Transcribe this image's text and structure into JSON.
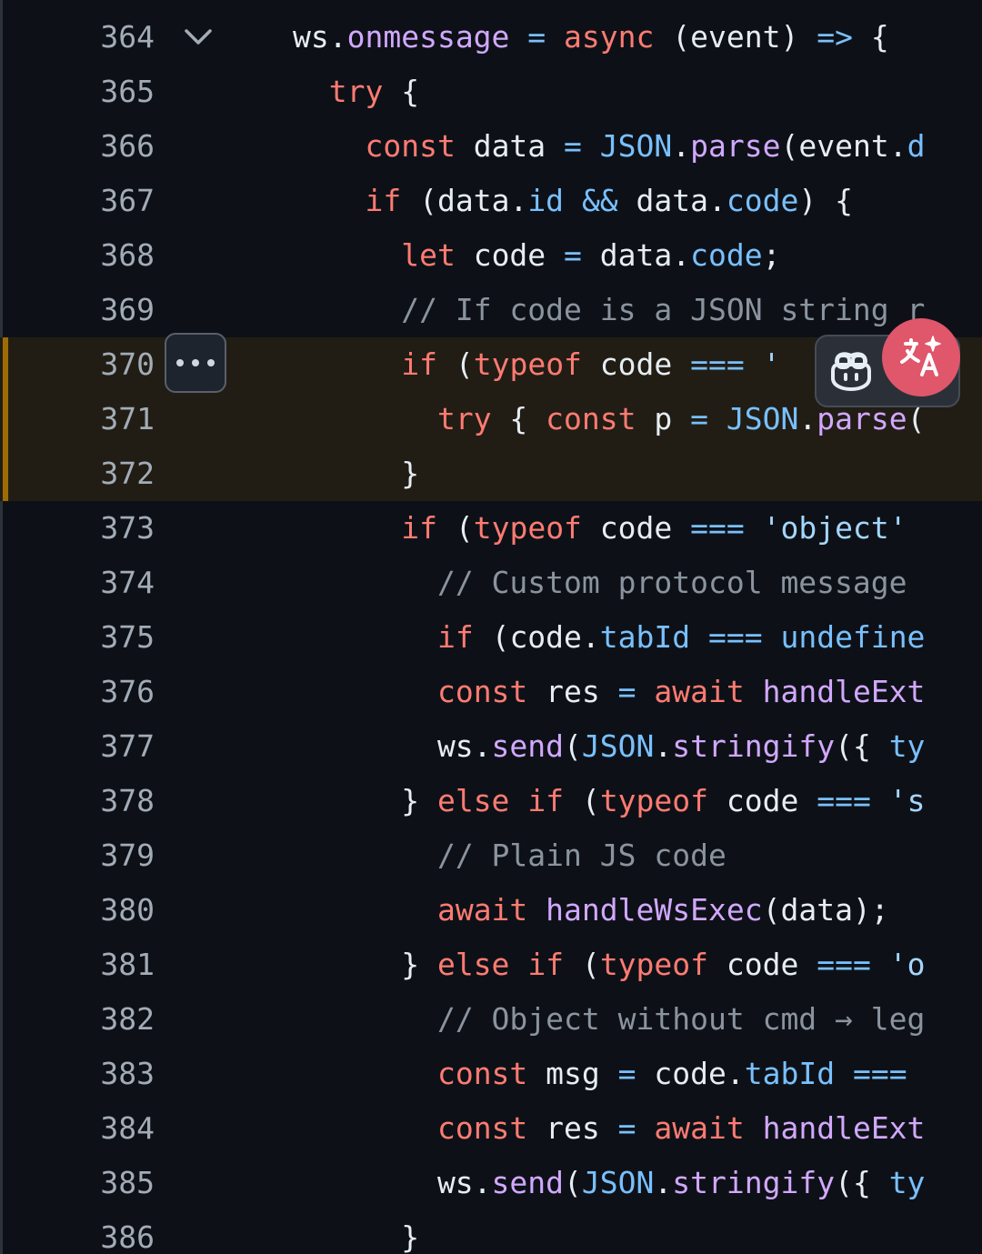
{
  "editor": {
    "highlighted_lines": [
      370,
      371,
      372
    ],
    "lines": [
      {
        "number": "364",
        "foldable": true,
        "tokens": [
          [
            "pl",
            "ws."
          ],
          [
            "fn",
            "onmessage"
          ],
          [
            "pl",
            " "
          ],
          [
            "pr",
            "="
          ],
          [
            "pl",
            " "
          ],
          [
            "kw",
            "async"
          ],
          [
            "pl",
            " (event) "
          ],
          [
            "pr",
            "=>"
          ],
          [
            "pl",
            " {"
          ]
        ]
      },
      {
        "number": "365",
        "tokens": [
          [
            "pl",
            "  "
          ],
          [
            "kw",
            "try"
          ],
          [
            "pl",
            " {"
          ]
        ]
      },
      {
        "number": "366",
        "tokens": [
          [
            "pl",
            "    "
          ],
          [
            "kw",
            "const"
          ],
          [
            "pl",
            " data "
          ],
          [
            "pr",
            "="
          ],
          [
            "pl",
            " "
          ],
          [
            "pr",
            "JSON"
          ],
          [
            "pl",
            "."
          ],
          [
            "fn",
            "parse"
          ],
          [
            "pl",
            "(event."
          ],
          [
            "pr",
            "d"
          ]
        ]
      },
      {
        "number": "367",
        "tokens": [
          [
            "pl",
            "    "
          ],
          [
            "kw",
            "if"
          ],
          [
            "pl",
            " (data."
          ],
          [
            "pr",
            "id"
          ],
          [
            "pl",
            " "
          ],
          [
            "pr",
            "&&"
          ],
          [
            "pl",
            " data."
          ],
          [
            "pr",
            "code"
          ],
          [
            "pl",
            ") {"
          ]
        ]
      },
      {
        "number": "368",
        "tokens": [
          [
            "pl",
            "      "
          ],
          [
            "kw",
            "let"
          ],
          [
            "pl",
            " code "
          ],
          [
            "pr",
            "="
          ],
          [
            "pl",
            " data."
          ],
          [
            "pr",
            "code"
          ],
          [
            "pl",
            ";"
          ]
        ]
      },
      {
        "number": "369",
        "tokens": [
          [
            "pl",
            "      "
          ],
          [
            "cm",
            "// If code is a JSON string r"
          ]
        ]
      },
      {
        "number": "370",
        "tokens": [
          [
            "pl",
            "      "
          ],
          [
            "kw",
            "if"
          ],
          [
            "pl",
            " ("
          ],
          [
            "kw",
            "typeof"
          ],
          [
            "pl",
            " code "
          ],
          [
            "pr",
            "==="
          ],
          [
            "pl",
            " "
          ],
          [
            "str",
            "'"
          ]
        ]
      },
      {
        "number": "371",
        "tokens": [
          [
            "pl",
            "        "
          ],
          [
            "kw",
            "try"
          ],
          [
            "pl",
            " { "
          ],
          [
            "kw",
            "const"
          ],
          [
            "pl",
            " p "
          ],
          [
            "pr",
            "="
          ],
          [
            "pl",
            " "
          ],
          [
            "pr",
            "JSON"
          ],
          [
            "pl",
            "."
          ],
          [
            "fn",
            "parse"
          ],
          [
            "pl",
            "("
          ]
        ]
      },
      {
        "number": "372",
        "tokens": [
          [
            "pl",
            "      }"
          ]
        ]
      },
      {
        "number": "373",
        "tokens": [
          [
            "pl",
            "      "
          ],
          [
            "kw",
            "if"
          ],
          [
            "pl",
            " ("
          ],
          [
            "kw",
            "typeof"
          ],
          [
            "pl",
            " code "
          ],
          [
            "pr",
            "==="
          ],
          [
            "pl",
            " "
          ],
          [
            "str",
            "'object'"
          ]
        ]
      },
      {
        "number": "374",
        "tokens": [
          [
            "pl",
            "        "
          ],
          [
            "cm",
            "// Custom protocol message"
          ]
        ]
      },
      {
        "number": "375",
        "tokens": [
          [
            "pl",
            "        "
          ],
          [
            "kw",
            "if"
          ],
          [
            "pl",
            " (code."
          ],
          [
            "pr",
            "tabId"
          ],
          [
            "pl",
            " "
          ],
          [
            "pr",
            "==="
          ],
          [
            "pl",
            " "
          ],
          [
            "pr",
            "undefine"
          ]
        ]
      },
      {
        "number": "376",
        "tokens": [
          [
            "pl",
            "        "
          ],
          [
            "kw",
            "const"
          ],
          [
            "pl",
            " res "
          ],
          [
            "pr",
            "="
          ],
          [
            "pl",
            " "
          ],
          [
            "kw",
            "await"
          ],
          [
            "pl",
            " "
          ],
          [
            "fn",
            "handleExt"
          ]
        ]
      },
      {
        "number": "377",
        "tokens": [
          [
            "pl",
            "        ws."
          ],
          [
            "fn",
            "send"
          ],
          [
            "pl",
            "("
          ],
          [
            "pr",
            "JSON"
          ],
          [
            "pl",
            "."
          ],
          [
            "fn",
            "stringify"
          ],
          [
            "pl",
            "({ "
          ],
          [
            "pr",
            "ty"
          ]
        ]
      },
      {
        "number": "378",
        "tokens": [
          [
            "pl",
            "      } "
          ],
          [
            "kw",
            "else"
          ],
          [
            "pl",
            " "
          ],
          [
            "kw",
            "if"
          ],
          [
            "pl",
            " ("
          ],
          [
            "kw",
            "typeof"
          ],
          [
            "pl",
            " code "
          ],
          [
            "pr",
            "==="
          ],
          [
            "pl",
            " "
          ],
          [
            "str",
            "'s"
          ]
        ]
      },
      {
        "number": "379",
        "tokens": [
          [
            "pl",
            "        "
          ],
          [
            "cm",
            "// Plain JS code"
          ]
        ]
      },
      {
        "number": "380",
        "tokens": [
          [
            "pl",
            "        "
          ],
          [
            "kw",
            "await"
          ],
          [
            "pl",
            " "
          ],
          [
            "fn",
            "handleWsExec"
          ],
          [
            "pl",
            "(data);"
          ]
        ]
      },
      {
        "number": "381",
        "tokens": [
          [
            "pl",
            "      } "
          ],
          [
            "kw",
            "else"
          ],
          [
            "pl",
            " "
          ],
          [
            "kw",
            "if"
          ],
          [
            "pl",
            " ("
          ],
          [
            "kw",
            "typeof"
          ],
          [
            "pl",
            " code "
          ],
          [
            "pr",
            "==="
          ],
          [
            "pl",
            " "
          ],
          [
            "str",
            "'o"
          ]
        ]
      },
      {
        "number": "382",
        "tokens": [
          [
            "pl",
            "        "
          ],
          [
            "cm",
            "// Object without cmd → leg"
          ]
        ]
      },
      {
        "number": "383",
        "tokens": [
          [
            "pl",
            "        "
          ],
          [
            "kw",
            "const"
          ],
          [
            "pl",
            " msg "
          ],
          [
            "pr",
            "="
          ],
          [
            "pl",
            " code."
          ],
          [
            "pr",
            "tabId"
          ],
          [
            "pl",
            " "
          ],
          [
            "pr",
            "==="
          ]
        ]
      },
      {
        "number": "384",
        "tokens": [
          [
            "pl",
            "        "
          ],
          [
            "kw",
            "const"
          ],
          [
            "pl",
            " res "
          ],
          [
            "pr",
            "="
          ],
          [
            "pl",
            " "
          ],
          [
            "kw",
            "await"
          ],
          [
            "pl",
            " "
          ],
          [
            "fn",
            "handleExt"
          ]
        ]
      },
      {
        "number": "385",
        "tokens": [
          [
            "pl",
            "        ws."
          ],
          [
            "fn",
            "send"
          ],
          [
            "pl",
            "("
          ],
          [
            "pr",
            "JSON"
          ],
          [
            "pl",
            "."
          ],
          [
            "fn",
            "stringify"
          ],
          [
            "pl",
            "({ "
          ],
          [
            "pr",
            "ty"
          ]
        ]
      },
      {
        "number": "386",
        "tokens": [
          [
            "pl",
            "      }"
          ]
        ]
      }
    ]
  },
  "icons": {
    "fold": "chevron-down-icon",
    "more": "kebab-horizontal-icon",
    "copilot": "copilot-icon",
    "translate": "translate-icon"
  },
  "colors": {
    "background": "#0d1117",
    "keyword": "#ff7b72",
    "function": "#d2a8ff",
    "property": "#79c0ff",
    "string": "#a5d6ff",
    "comment": "#8b949e",
    "line_number": "#a3acb6",
    "highlight_band": "#211d15",
    "highlight_bar": "#9e6a03",
    "translate_button": "#e0566b"
  }
}
